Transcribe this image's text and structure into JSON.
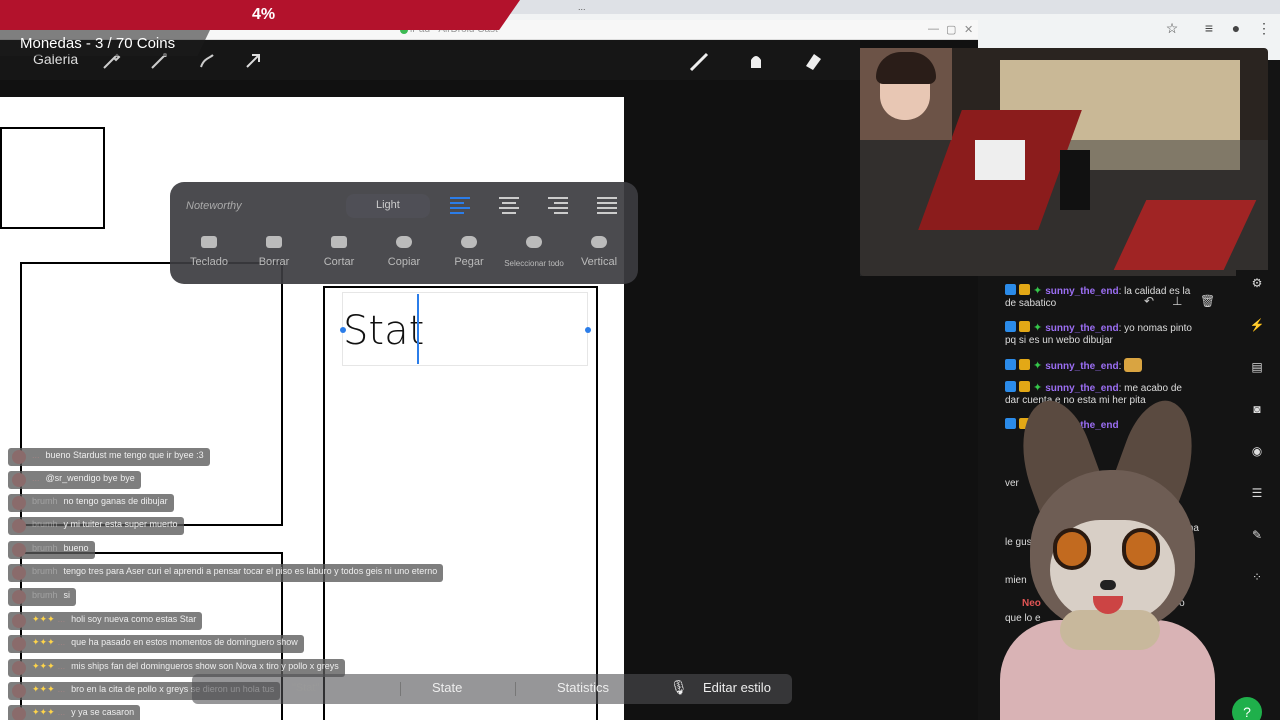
{
  "browser": {
    "tabs": [
      "...",
      "...",
      "...",
      "..."
    ],
    "window_title": "iPad - AirDroid Cast"
  },
  "overlay": {
    "progress_pct": "4%",
    "progress_value": 0.04,
    "coins_label": "Monedas - 3 / 70 Coins"
  },
  "procreate": {
    "gallery_label": "Galeria",
    "text_content": "Stat",
    "popup": {
      "font_name": "Noteworthy",
      "style": "Light",
      "actions": [
        "Teclado",
        "Borrar",
        "Cortar",
        "Copiar",
        "Pegar",
        "Seleccionar todo",
        "Vertical"
      ]
    }
  },
  "keyboard": {
    "suggestions": [
      "\"Stat\"",
      "State",
      "Statistics"
    ],
    "edit_style": "Editar estilo"
  },
  "overlay_chat": [
    {
      "user": "...",
      "text": "bueno Stardust me tengo que ir byee :3"
    },
    {
      "user": "...",
      "text": "@sr_wendigo bye bye"
    },
    {
      "user": "brumh",
      "text": "no tengo ganas de dibujar"
    },
    {
      "user": "brumh",
      "text": "y mi tuiter esta super muerto"
    },
    {
      "user": "brumh",
      "text": "bueno"
    },
    {
      "user": "brumh",
      "text": "tengo tres para Aser curi el aprendi a pensar tocar el piso es laburo y todos geis ni uno eterno"
    },
    {
      "user": "brumh",
      "text": "si"
    },
    {
      "user": "...",
      "text": "holi soy nueva como estas Star"
    },
    {
      "user": "...",
      "text": "que ha pasado en estos momentos de dominguero show"
    },
    {
      "user": "...",
      "text": "mis ships fan del domingueros show son Nova x tiro y pollo x greys"
    },
    {
      "user": "...",
      "text": "bro en la cita de pollo x greys se dieron un hola tus"
    },
    {
      "user": "...",
      "text": "y ya se casaron"
    }
  ],
  "side_chat": [
    {
      "user": "sunny_the_end",
      "text": "la calidad es la",
      "cont": "de sabatico"
    },
    {
      "user": "sunny_the_end",
      "text": "yo nomas pinto",
      "cont": "pq si es un webo dibujar"
    },
    {
      "user": "sunny_the_end",
      "text": "",
      "cont": ""
    },
    {
      "user": "sunny_the_end",
      "text": "me acabo de",
      "cont": "dar cuenta    e no esta mi her    pita"
    },
    {
      "user": "sunny_the_end",
      "text": "",
      "cont": ""
    }
  ],
  "side_chat_fragments": [
    "ver",
    "kma",
    "le gus",
    "mien",
    "Neo",
    "deo",
    "que lo e"
  ],
  "colors": {
    "accent_red": "#b3122c",
    "chat_user": "#9b6ef3",
    "ipad_blue": "#2b7de9",
    "green_button": "#1fb04b"
  }
}
